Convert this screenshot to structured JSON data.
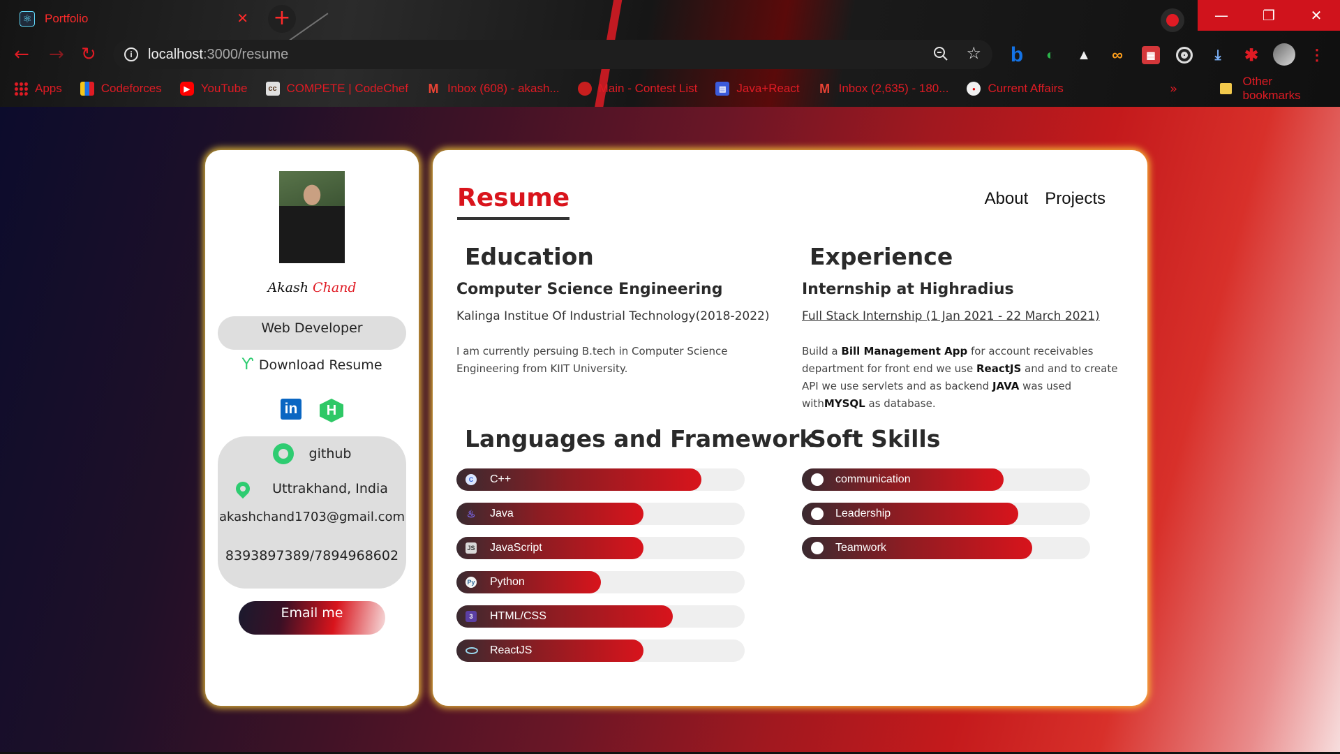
{
  "browser": {
    "tab_title": "Portfolio",
    "tab_close": "✕",
    "new_tab": "+",
    "url_host": "localhost",
    "url_path": ":3000/resume",
    "window_controls": [
      "—",
      "❐",
      "✕"
    ],
    "bookmarks": [
      {
        "label": "Apps",
        "icon": "apps-grid-icon"
      },
      {
        "label": "Codeforces",
        "icon": "codeforces-icon"
      },
      {
        "label": "YouTube",
        "icon": "youtube-icon"
      },
      {
        "label": "COMPETE | CodeChef",
        "icon": "codechef-icon"
      },
      {
        "label": "Inbox (608) - akash...",
        "icon": "gmail-icon"
      },
      {
        "label": "Main - Contest List",
        "icon": "contest-icon"
      },
      {
        "label": "Java+React",
        "icon": "java-react-icon"
      },
      {
        "label": "Inbox (2,635) - 180...",
        "icon": "gmail-icon"
      },
      {
        "label": "Current Affairs",
        "icon": "current-affairs-icon"
      }
    ],
    "bookmarks_more": "»",
    "other_bookmarks": "Other bookmarks",
    "accent_color": "#e01b24"
  },
  "profile": {
    "first_name": "Akash",
    "last_name": "Chand",
    "role": "Web Developer",
    "download_label": "Download Resume",
    "github_label": "github",
    "location": "Uttrakhand, India",
    "email": "akashchand1703@gmail.com",
    "phone": "8393897389/7894968602",
    "email_button": "Email me"
  },
  "resume": {
    "title": "Resume",
    "nav": [
      "About",
      "Projects"
    ],
    "education": {
      "heading": "Education",
      "degree": "Computer Science Engineering",
      "institute": "Kalinga Institue Of Industrial Technology(2018-2022)",
      "description": "I am currently persuing B.tech in Computer Science Engineering from KIIT University."
    },
    "experience": {
      "heading": "Experience",
      "role": "Internship at Highradius",
      "period": "Full Stack Internship (1 Jan 2021 - 22 March 2021)",
      "desc_parts": [
        {
          "text": "Build a ",
          "bold": false
        },
        {
          "text": "Bill Management App",
          "bold": true
        },
        {
          "text": " for account receivables department for front end we use ",
          "bold": false
        },
        {
          "text": "ReactJS",
          "bold": true
        },
        {
          "text": " and and to create API we use servlets and as backend ",
          "bold": false
        },
        {
          "text": "JAVA",
          "bold": true
        },
        {
          "text": " was used with",
          "bold": false
        },
        {
          "text": "MYSQL",
          "bold": true
        },
        {
          "text": " as database.",
          "bold": false
        }
      ]
    },
    "languages": {
      "heading": "Languages and Framework",
      "items": [
        {
          "name": "C++",
          "level": 0.85,
          "icon": "cpp-icon",
          "glyph": "C"
        },
        {
          "name": "Java",
          "level": 0.65,
          "icon": "java-icon",
          "glyph": "♨"
        },
        {
          "name": "JavaScript",
          "level": 0.65,
          "icon": "javascript-icon",
          "glyph": "JS"
        },
        {
          "name": "Python",
          "level": 0.5,
          "icon": "python-icon",
          "glyph": "Py"
        },
        {
          "name": "HTML/CSS",
          "level": 0.75,
          "icon": "css-icon",
          "glyph": "3"
        },
        {
          "name": "ReactJS",
          "level": 0.65,
          "icon": "react-icon",
          "glyph": ""
        }
      ]
    },
    "soft_skills": {
      "heading": "Soft Skills",
      "items": [
        {
          "name": "communication",
          "level": 0.7
        },
        {
          "name": "Leadership",
          "level": 0.75
        },
        {
          "name": "Teamwork",
          "level": 0.8
        }
      ]
    }
  }
}
